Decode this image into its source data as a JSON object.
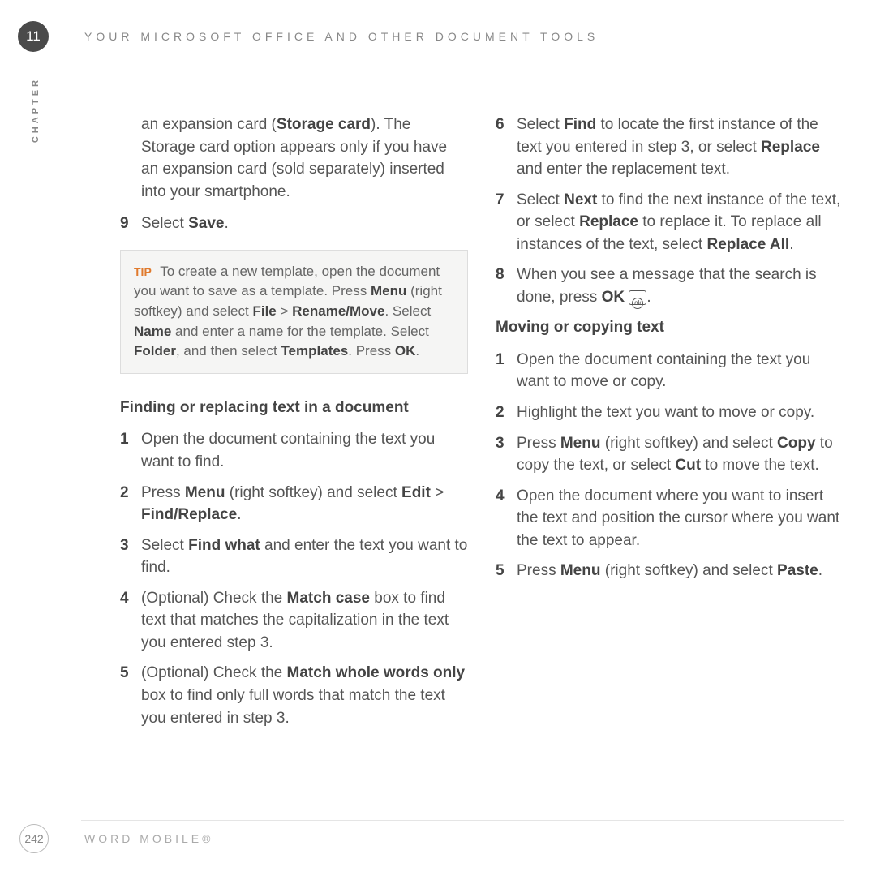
{
  "header": {
    "chapter_number": "11",
    "title": "YOUR MICROSOFT OFFICE AND OTHER DOCUMENT TOOLS",
    "chapter_label": "CHAPTER"
  },
  "left": {
    "intro_pre": "an expansion card (",
    "intro_bold": "Storage card",
    "intro_post": "). The Storage card option appears only if you have an expansion card (sold separately) inserted into your smartphone.",
    "step9_num": "9",
    "step9_pre": "Select ",
    "step9_b": "Save",
    "step9_post": ".",
    "tip_label": "TIP",
    "tip_t1": " To create a new template, open the document you want to save as a template. Press ",
    "tip_b1": "Menu",
    "tip_t2": " (right softkey) and select ",
    "tip_b2": "File",
    "tip_t3": " > ",
    "tip_b3": "Rename/Move",
    "tip_t4": ". Select ",
    "tip_b4": "Name",
    "tip_t5": " and enter a name for the template. Select ",
    "tip_b5": "Folder",
    "tip_t6": ", and then select ",
    "tip_b6": "Templates",
    "tip_t7": ". Press ",
    "tip_b7": "OK",
    "tip_t8": ".",
    "sectionA": "Finding or replacing text in a document",
    "s1n": "1",
    "s1": "Open the document containing the text you want to find.",
    "s2n": "2",
    "s2_pre": "Press ",
    "s2_b1": "Menu",
    "s2_mid": " (right softkey) and select ",
    "s2_b2": "Edit",
    "s2_gt": " > ",
    "s2_b3": "Find/Replace",
    "s2_post": ".",
    "s3n": "3",
    "s3_pre": "Select ",
    "s3_b": "Find what",
    "s3_post": " and enter the text you want to find.",
    "s4n": "4",
    "s4_pre": "(Optional) Check the ",
    "s4_b": "Match case",
    "s4_post": " box to find text that matches the capitalization in the text you entered step 3.",
    "s5n": "5",
    "s5_pre": "(Optional) Check the ",
    "s5_b": "Match whole words only",
    "s5_post": " box to find only full words that match the text you entered in step 3."
  },
  "right": {
    "s6n": "6",
    "s6_pre": "Select ",
    "s6_b1": "Find",
    "s6_mid": " to locate the first instance of the text you entered in step 3, or select ",
    "s6_b2": "Replace",
    "s6_post": " and enter the replacement text.",
    "s7n": "7",
    "s7_pre": "Select ",
    "s7_b1": "Next",
    "s7_mid1": " to find the next instance of the text, or select ",
    "s7_b2": "Replace",
    "s7_mid2": " to replace it. To replace all instances of the text, select ",
    "s7_b3": "Replace All",
    "s7_post": ".",
    "s8n": "8",
    "s8_pre": "When you see a message that the search is done, press ",
    "s8_b": "OK",
    "s8_post": ".",
    "ok_icon_text": "ok",
    "sectionB": "Moving or copying text",
    "m1n": "1",
    "m1": "Open the document containing the text you want to move or copy.",
    "m2n": "2",
    "m2": "Highlight the text you want to move or copy.",
    "m3n": "3",
    "m3_pre": "Press ",
    "m3_b1": "Menu",
    "m3_mid1": " (right softkey) and select ",
    "m3_b2": "Copy",
    "m3_mid2": " to copy the text, or select ",
    "m3_b3": "Cut",
    "m3_post": " to move the text.",
    "m4n": "4",
    "m4": "Open the document where you want to insert the text and position the cursor where you want the text to appear.",
    "m5n": "5",
    "m5_pre": "Press ",
    "m5_b1": "Menu",
    "m5_mid": " (right softkey) and select ",
    "m5_b2": "Paste",
    "m5_post": "."
  },
  "footer": {
    "page": "242",
    "title": "WORD MOBILE®"
  }
}
